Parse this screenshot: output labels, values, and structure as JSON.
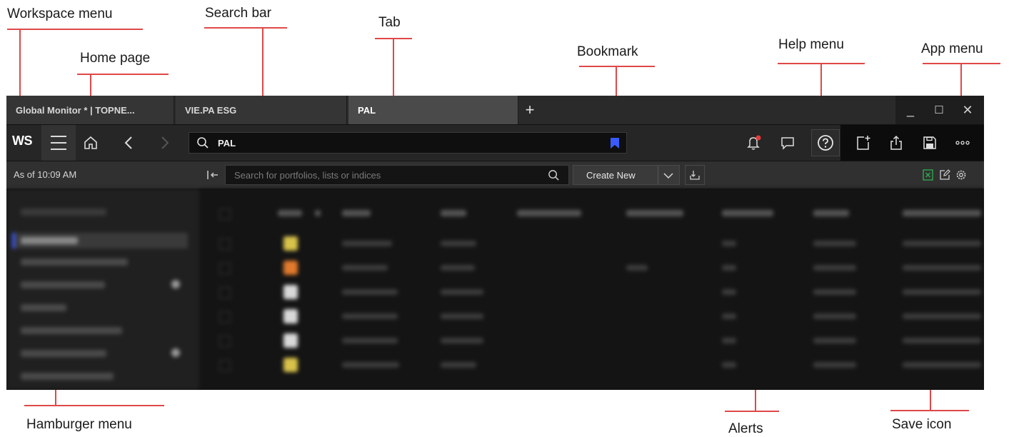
{
  "annotations": {
    "workspace_menu": "Workspace menu",
    "search_bar": "Search bar",
    "tab": "Tab",
    "home_page": "Home page",
    "bookmark": "Bookmark",
    "help_menu": "Help menu",
    "app_menu": "App menu",
    "hamburger_menu": "Hamburger menu",
    "alerts": "Alerts",
    "save_icon": "Save icon"
  },
  "colors": {
    "annotation_line": "#e04848",
    "bookmark": "#3a5bff",
    "alert_dot": "#e63b3b",
    "excel_green": "#2fa84f"
  },
  "tabs": [
    {
      "label": "Global Monitor * | TOPNE...",
      "active": false
    },
    {
      "label": "VIE.PA ESG",
      "active": false
    },
    {
      "label": "PAL",
      "active": true
    }
  ],
  "tab_add": "+",
  "window_controls": {
    "minimize": "_",
    "maximize": "☐",
    "close": "✕"
  },
  "toolbar": {
    "workspace_label": "WS",
    "search_value": "PAL",
    "icons": [
      "hamburger-icon",
      "home-icon",
      "back-icon",
      "forward-icon",
      "search-icon",
      "bookmark-icon",
      "alert-bell-icon",
      "chat-icon",
      "help-icon",
      "new-window-icon",
      "share-icon",
      "save-icon",
      "more-icon"
    ]
  },
  "subbar": {
    "as_of": "As of 10:09 AM",
    "search_placeholder": "Search for portfolios, lists or indices",
    "create_new_label": "Create New"
  }
}
